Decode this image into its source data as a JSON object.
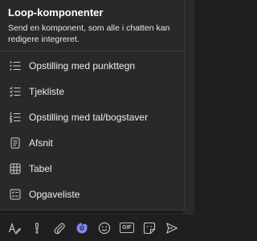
{
  "popup": {
    "title": "Loop-komponenter",
    "description": "Send en komponent, som alle i chatten kan redigere integreret.",
    "items": [
      {
        "label": "Opstilling med punkttegn",
        "icon": "bulleted-list-icon"
      },
      {
        "label": "Tjekliste",
        "icon": "checklist-icon"
      },
      {
        "label": "Opstilling med tal/bogstaver",
        "icon": "numbered-list-icon"
      },
      {
        "label": "Afsnit",
        "icon": "paragraph-icon"
      },
      {
        "label": "Tabel",
        "icon": "table-icon"
      },
      {
        "label": "Opgaveliste",
        "icon": "task-list-icon"
      }
    ]
  },
  "toolbar": {
    "items": [
      {
        "icon": "format-icon"
      },
      {
        "icon": "important-icon"
      },
      {
        "icon": "attach-icon"
      },
      {
        "icon": "loop-icon",
        "active": true
      },
      {
        "icon": "emoji-icon"
      },
      {
        "icon": "gif-icon",
        "label": "GIF"
      },
      {
        "icon": "sticker-icon"
      },
      {
        "icon": "send-icon"
      }
    ]
  },
  "colors": {
    "popup_bg": "#292929",
    "text": "#ececec",
    "icon": "#d0d0d0",
    "accent": "#7f85f5"
  }
}
